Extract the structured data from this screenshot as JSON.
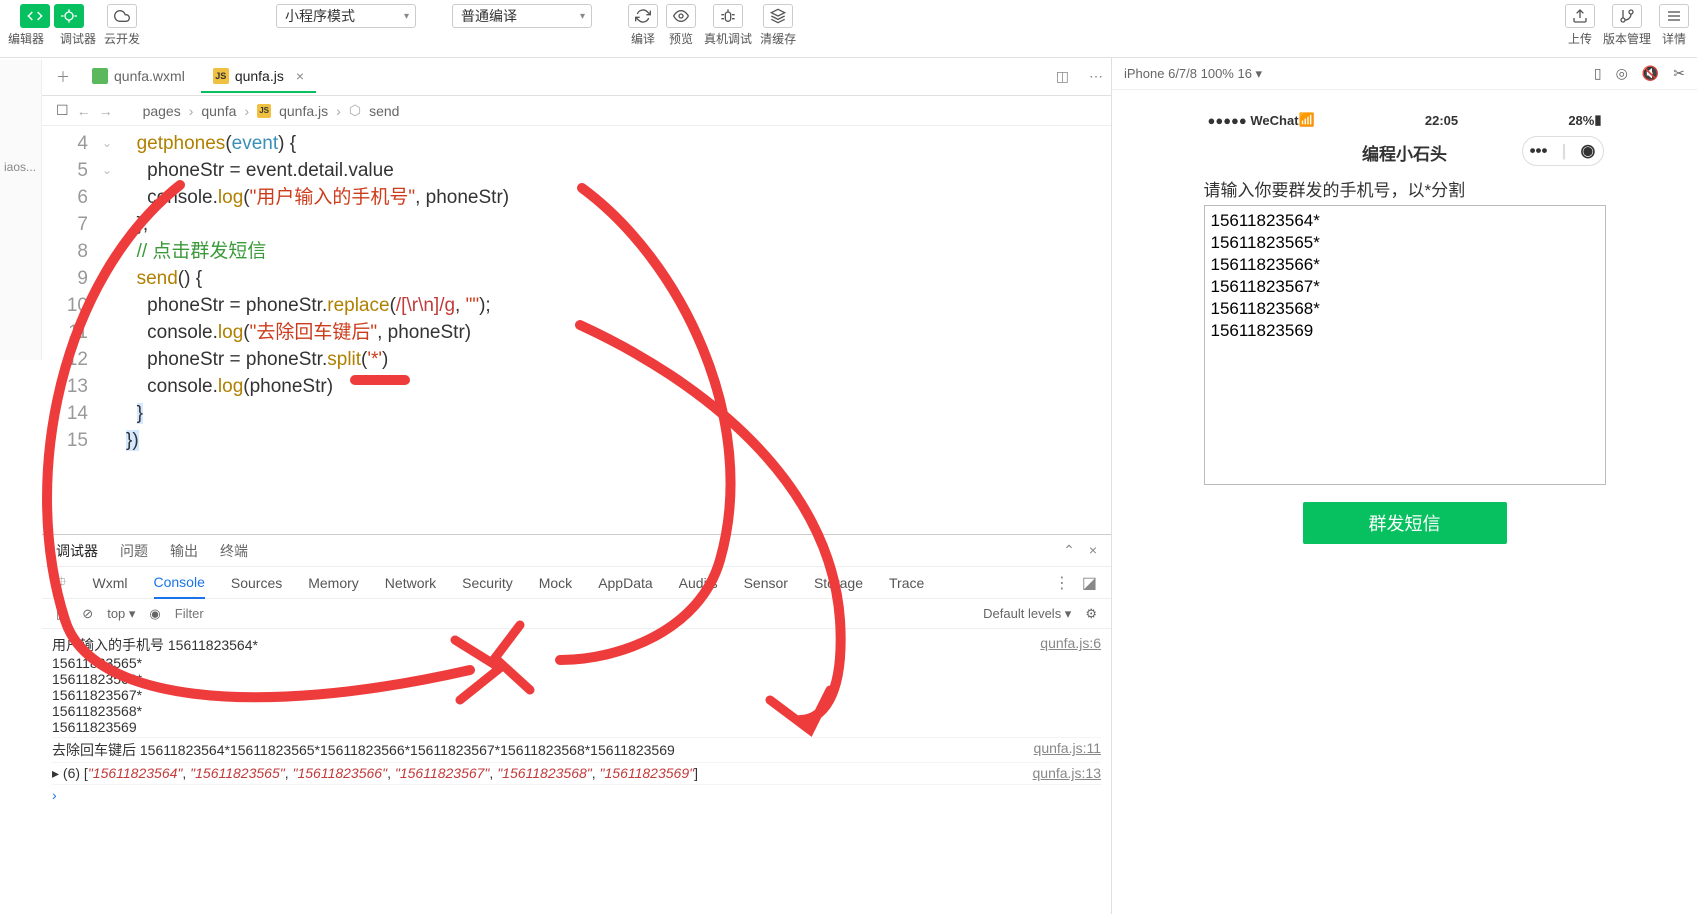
{
  "toolbar": {
    "ed_label": "编辑器",
    "dbg_label": "调试器",
    "cloud_label": "云开发",
    "mode_dd": "小程序模式",
    "compile_dd": "普通编译",
    "compile_btn": "编译",
    "preview_btn": "预览",
    "real_btn": "真机调试",
    "clear_btn": "清缓存",
    "upload_btn": "上传",
    "ver_btn": "版本管理",
    "detail_btn": "详情"
  },
  "tabs": {
    "wxml": "qunfa.wxml",
    "js": "qunfa.js"
  },
  "crumbs": {
    "a": "pages",
    "b": "qunfa",
    "c": "qunfa.js",
    "d": "send"
  },
  "code": {
    "l4a": "getphones",
    "l4b": "event",
    "l5": "phoneStr = event.detail.value",
    "l6a": "console",
    "l6b": "log",
    "l6str": "\"用户输入的手机号\"",
    "l6c": ", phoneStr)",
    "l8": "// 点击群发短信",
    "l9": "send",
    "l10a": "phoneStr = phoneStr.",
    "l10b": "replace",
    "l10c": "(",
    "l10re": "/[\\r\\n]/g",
    "l10d": ", ",
    "l10str": "\"\"",
    "l10e": ");",
    "l11a": "console.",
    "l11b": "log",
    "l11c": "(",
    "l11str": "\"去除回车键后\"",
    "l11d": ", phoneStr)",
    "l12a": "phoneStr = phoneStr.",
    "l12b": "split",
    "l12c": "(",
    "l12str": "'*'",
    "l12d": ")",
    "l13a": "console.",
    "l13b": "log",
    "l13c": "(phoneStr)",
    "ln4": "4",
    "ln5": "5",
    "ln6": "6",
    "ln7": "7",
    "ln8": "8",
    "ln9": "9",
    "ln10": "10",
    "ln11": "11",
    "ln12": "12",
    "ln13": "13",
    "ln14": "14",
    "ln15": "15"
  },
  "dbg": {
    "t1": "调试器",
    "t2": "问题",
    "t3": "输出",
    "t4": "终端",
    "d1": "Wxml",
    "d2": "Console",
    "d3": "Sources",
    "d4": "Memory",
    "d5": "Network",
    "d6": "Security",
    "d7": "Mock",
    "d8": "AppData",
    "d9": "Audits",
    "d10": "Sensor",
    "d11": "Storage",
    "d12": "Trace",
    "ctx": "top",
    "filter_ph": "Filter",
    "levels": "Default levels ▾"
  },
  "console": {
    "r1": "用户输入的手机号 15611823564*\n15611823565*\n15611823566*\n15611823567*\n15611823568*\n15611823569",
    "s1": "qunfa.js:6",
    "r2": "去除回车键后 15611823564*15611823565*15611823566*15611823567*15611823568*15611823569",
    "s2": "qunfa.js:11",
    "r3pre": "▸ (6) [",
    "r3a": "\"15611823564\"",
    "r3b": "\"15611823565\"",
    "r3c": "\"15611823566\"",
    "r3d": "\"15611823567\"",
    "r3e": "\"15611823568\"",
    "r3f": "\"15611823569\"",
    "r3post": "]",
    "s3": "qunfa.js:13"
  },
  "sim": {
    "device": "iPhone 6/7/8 100% 16 ▾",
    "carrier": "●●●●● WeChat",
    "time": "22:05",
    "batt": "28%",
    "title": "编程小石头",
    "label": "请输入你要群发的手机号，以*分割",
    "textarea": "15611823564*\n15611823565*\n15611823566*\n15611823567*\n15611823568*\n15611823569",
    "send": "群发短信"
  },
  "sidebar_txt": "iaos..."
}
